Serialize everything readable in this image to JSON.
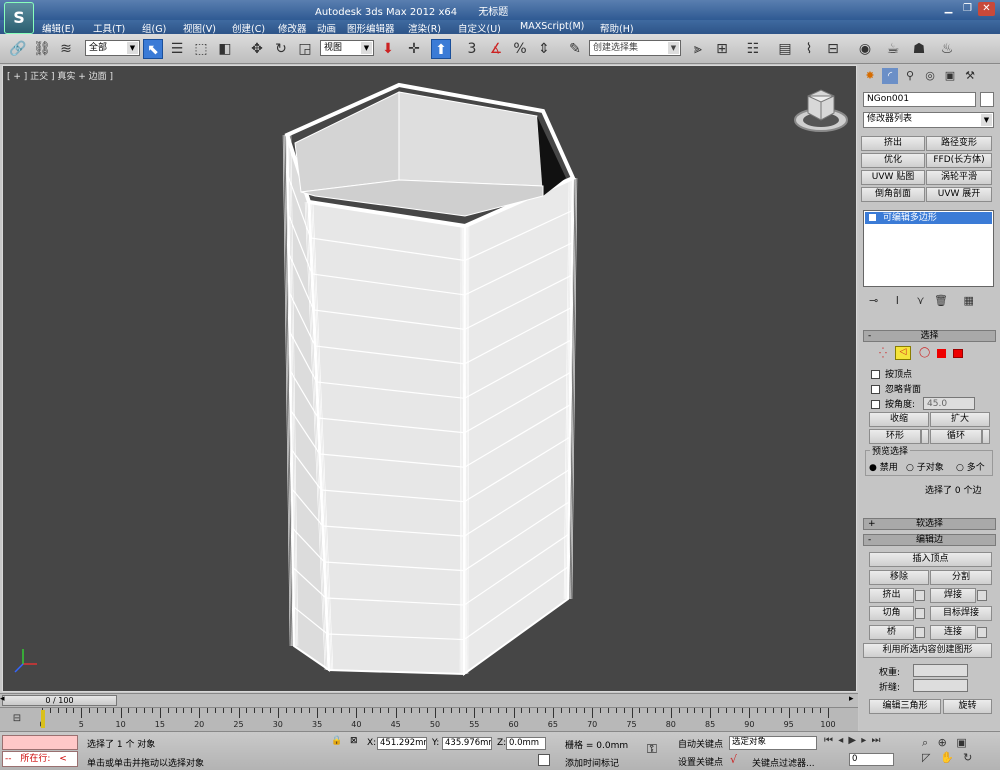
{
  "window": {
    "app_title": "Autodesk 3ds Max  2012 x64",
    "document_title": "无标题",
    "minimize": "▁",
    "maximize": "❐",
    "close": "✕"
  },
  "app_logo": "S",
  "menu": [
    "编辑(E)",
    "工具(T)",
    "组(G)",
    "视图(V)",
    "创建(C)",
    "修改器",
    "动画",
    "图形编辑器",
    "渲染(R)",
    "自定义(U)",
    "MAXScript(M)",
    "帮助(H)"
  ],
  "toolbar": {
    "selection_filter": "全部",
    "reference_coord": "视图",
    "named_selection_placeholder": "创建选择集",
    "snap_label": "3",
    "percent_snap": "%"
  },
  "viewport": {
    "label": "[ + ] 正交 ] 真实 + 边面 ]"
  },
  "command_panel": {
    "object_name": "NGon001",
    "modifier_list": "修改器列表",
    "modifier_buttons": [
      "挤出",
      "路径变形",
      "优化",
      "FFD(长方体)",
      "UVW 贴图",
      "涡轮平滑",
      "倒角剖面",
      "UVW 展开"
    ],
    "stack_item": "可编辑多边形",
    "selection_rollout": {
      "title": "选择",
      "by_vertex": "按顶点",
      "ignore_backfacing": "忽略背面",
      "by_angle": "按角度:",
      "angle_value": "45.0",
      "shrink": "收缩",
      "grow": "扩大",
      "ring": "环形",
      "loop": "循环",
      "preview_group": "预览选择",
      "preview_off": "禁用",
      "preview_subobj": "子对象",
      "preview_multi": "多个",
      "status": "选择了 0 个边"
    },
    "soft_selection_title": "软选择",
    "edit_edges": {
      "title": "编辑边",
      "insert_vertex": "插入顶点",
      "remove": "移除",
      "split": "分割",
      "extrude": "挤出",
      "weld": "焊接",
      "chamfer": "切角",
      "target_weld": "目标焊接",
      "bridge": "桥",
      "connect": "连接",
      "create_shape": "利用所选内容创建图形",
      "weight": "权重:",
      "crease": "折缝:",
      "edit_tri": "编辑三角形",
      "rotate": "旋转"
    }
  },
  "timeline": {
    "slider": "0 / 100",
    "ticks": [
      0,
      5,
      10,
      15,
      20,
      25,
      30,
      35,
      40,
      45,
      50,
      55,
      60,
      65,
      70,
      75,
      80,
      85,
      90,
      95,
      100
    ]
  },
  "status": {
    "maxscript_label": "所在行:",
    "selected": "选择了 1 个 对象",
    "prompt": "单击或单击并拖动以选择对象",
    "x_label": "X:",
    "x_value": "451.292mm",
    "y_label": "Y:",
    "y_value": "435.976mm",
    "z_label": "Z:",
    "z_value": "0.0mm",
    "grid": "栅格 = 0.0mm",
    "add_time_tag": "添加时间标记",
    "auto_key": "自动关键点",
    "set_key": "设置关键点",
    "key_mode": "选定对象",
    "key_filters": "关键点过滤器...",
    "frame": "0"
  },
  "colors": {
    "viewport_bg": "#464646",
    "accent_blue": "#3b7bd6",
    "subobject_yellow": "#f5e43a"
  }
}
